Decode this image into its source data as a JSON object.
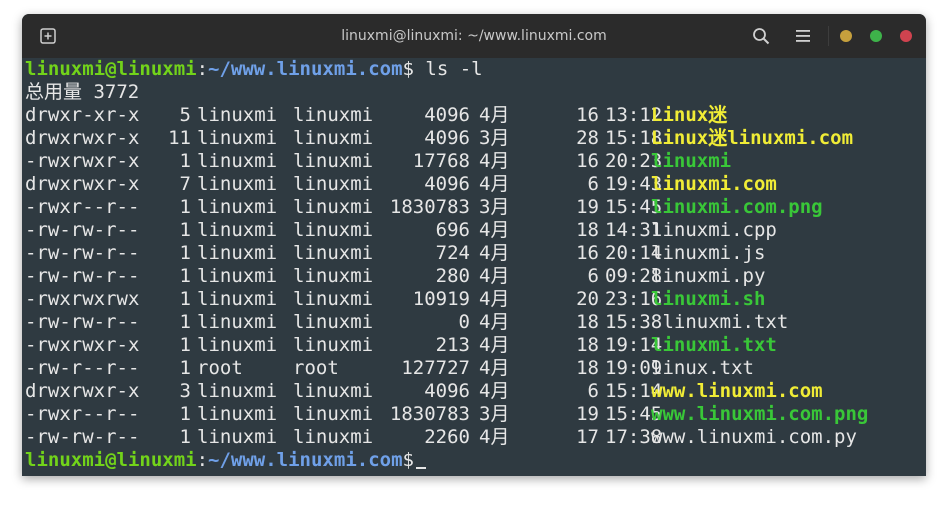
{
  "window": {
    "title": "linuxmi@linuxmi: ~/www.linuxmi.com",
    "icons": [
      "new-tab-icon",
      "search-icon",
      "hamburger-menu-icon"
    ],
    "colors": {
      "minimize": "#c6a03d",
      "maximize": "#3eb34a",
      "close": "#d0434f",
      "background": "#2f3a41"
    }
  },
  "terminal": {
    "prompt": {
      "user": "linuxmi@linuxmi",
      "colon": ":",
      "path": "~/www.linuxmi.com",
      "symbol": "$"
    },
    "command": " ls -l",
    "total": "总用量 3772",
    "rows": [
      {
        "perm": "drwxr-xr-x",
        "links": "5",
        "owner": "linuxmi",
        "group": "linuxmi",
        "size": "4096",
        "month": "4月",
        "day": "16",
        "time": "13:12",
        "name": "Linux迷",
        "kind": "dir"
      },
      {
        "perm": "drwxrwxr-x",
        "links": "11",
        "owner": "linuxmi",
        "group": "linuxmi",
        "size": "4096",
        "month": "3月",
        "day": "28",
        "time": "15:18",
        "name": "Linux迷linuxmi.com",
        "kind": "dir"
      },
      {
        "perm": "-rwxrwxr-x",
        "links": "1",
        "owner": "linuxmi",
        "group": "linuxmi",
        "size": "17768",
        "month": "4月",
        "day": "16",
        "time": "20:23",
        "name": "linuxmi",
        "kind": "exe"
      },
      {
        "perm": "drwxrwxr-x",
        "links": "7",
        "owner": "linuxmi",
        "group": "linuxmi",
        "size": "4096",
        "month": "4月",
        "day": "6",
        "time": "19:43",
        "name": "linuxmi.com",
        "kind": "dir"
      },
      {
        "perm": "-rwxr--r--",
        "links": "1",
        "owner": "linuxmi",
        "group": "linuxmi",
        "size": "1830783",
        "month": "3月",
        "day": "19",
        "time": "15:45",
        "name": "linuxmi.com.png",
        "kind": "exe"
      },
      {
        "perm": "-rw-rw-r--",
        "links": "1",
        "owner": "linuxmi",
        "group": "linuxmi",
        "size": "696",
        "month": "4月",
        "day": "18",
        "time": "14:31",
        "name": "linuxmi.cpp",
        "kind": "reg"
      },
      {
        "perm": "-rw-rw-r--",
        "links": "1",
        "owner": "linuxmi",
        "group": "linuxmi",
        "size": "724",
        "month": "4月",
        "day": "16",
        "time": "20:14",
        "name": "linuxmi.js",
        "kind": "reg"
      },
      {
        "perm": "-rw-rw-r--",
        "links": "1",
        "owner": "linuxmi",
        "group": "linuxmi",
        "size": "280",
        "month": "4月",
        "day": "6",
        "time": "09:28",
        "name": "linuxmi.py",
        "kind": "reg"
      },
      {
        "perm": "-rwxrwxrwx",
        "links": "1",
        "owner": "linuxmi",
        "group": "linuxmi",
        "size": "10919",
        "month": "4月",
        "day": "20",
        "time": "23:16",
        "name": "linuxmi.sh",
        "kind": "exe"
      },
      {
        "perm": "-rw-rw-r--",
        "links": "1",
        "owner": "linuxmi",
        "group": "linuxmi",
        "size": "0",
        "month": "4月",
        "day": "18",
        "time": "15:38",
        "name": " linuxmi.txt",
        "kind": "reg"
      },
      {
        "perm": "-rwxrwxr-x",
        "links": "1",
        "owner": "linuxmi",
        "group": "linuxmi",
        "size": "213",
        "month": "4月",
        "day": "18",
        "time": "19:14",
        "name": "linuxmi.txt",
        "kind": "exe"
      },
      {
        "perm": "-rw-r--r--",
        "links": "1",
        "owner": "root",
        "group": "root",
        "size": "127727",
        "month": "4月",
        "day": "18",
        "time": "19:09",
        "name": "linux.txt",
        "kind": "reg"
      },
      {
        "perm": "drwxrwxr-x",
        "links": "3",
        "owner": "linuxmi",
        "group": "linuxmi",
        "size": "4096",
        "month": "4月",
        "day": "6",
        "time": "15:14",
        "name": "www.linuxmi.com",
        "kind": "dir"
      },
      {
        "perm": "-rwxr--r--",
        "links": "1",
        "owner": "linuxmi",
        "group": "linuxmi",
        "size": "1830783",
        "month": "3月",
        "day": "19",
        "time": "15:45",
        "name": "www.linuxmi.com.png",
        "kind": "exe"
      },
      {
        "perm": "-rw-rw-r--",
        "links": "1",
        "owner": "linuxmi",
        "group": "linuxmi",
        "size": "2260",
        "month": "4月",
        "day": "17",
        "time": "17:38",
        "name": "www.linuxmi.com.py",
        "kind": "reg"
      }
    ]
  }
}
